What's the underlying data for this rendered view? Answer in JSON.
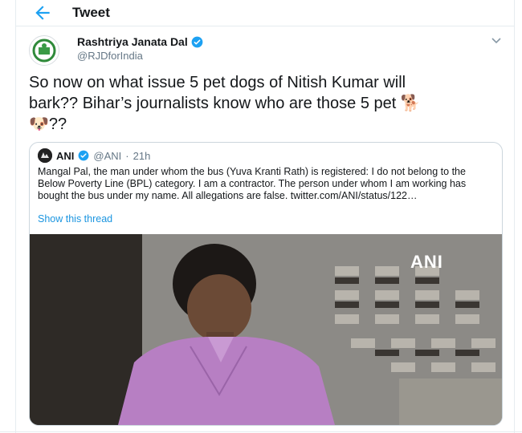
{
  "header": {
    "title": "Tweet",
    "back_icon": "arrow-left-icon"
  },
  "tweet": {
    "display_name": "Rashtriya Janata Dal",
    "handle": "@RJDforIndia",
    "verified": true,
    "text_line1": "So now on what issue 5 pet dogs of Nitish Kumar will",
    "text_line2_before": "bark?? Bihar’s journalists know who are those 5 pet ",
    "text_dog_emoji": "🐕",
    "text_dogface_emoji": "🐶",
    "text_end": "??"
  },
  "quoted_tweet": {
    "display_name": "ANI",
    "handle": "@ANI",
    "separator": "·",
    "time": "21h",
    "text": "Mangal Pal, the man under whom the bus (Yuva Kranti Rath) is registered: I do not belong to the Below Poverty Line (BPL) category. I am a contractor. The person under whom I am working has bought the bus under my name. All allegations are false. twitter.com/ANI/status/122…",
    "show_thread": "Show this thread",
    "media_watermark": "ANI"
  },
  "colors": {
    "accent": "#1da1f2",
    "verified": "#1da1f2",
    "link": "#1b95e0",
    "secondary_text": "#657786",
    "border": "#e6ecf0"
  }
}
